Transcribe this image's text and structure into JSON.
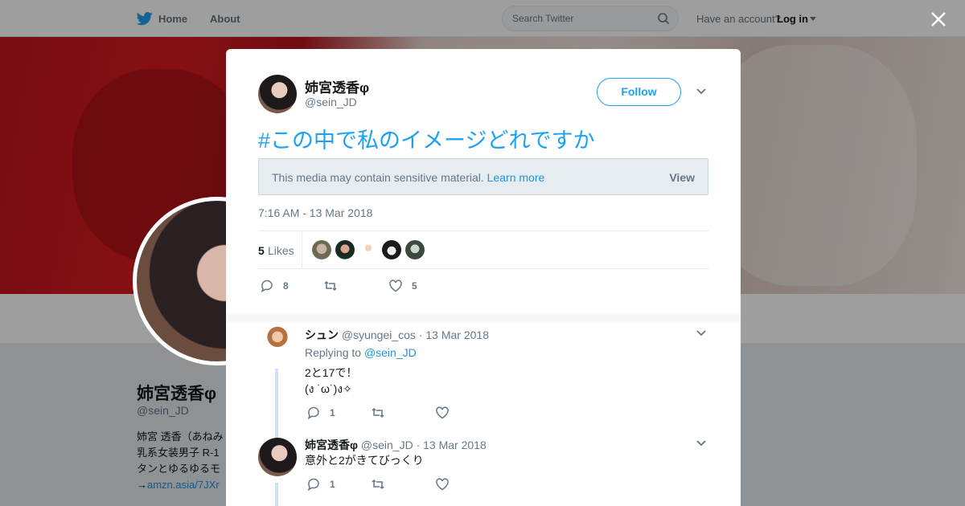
{
  "nav": {
    "home_label": "Home",
    "about_label": "About",
    "search_placeholder": "Search Twitter",
    "account_prompt": "Have an account?",
    "login_label": "Log in"
  },
  "background_profile": {
    "name": "姉宮透香φ",
    "handle": "@sein_JD",
    "bio_lines": [
      "姉宮 透香（あねみ",
      "乳系女装男子 R-1",
      "タンとゆるゆるモ"
    ],
    "bio_link_prefix": "→",
    "bio_link": "amzn.asia/7JXr"
  },
  "tweet": {
    "author_name": "姉宮透香φ",
    "author_handle": "@sein_JD",
    "follow_label": "Follow",
    "text": "#この中で私のイメージどれですか",
    "sensitive_text": "This media may contain sensitive material.",
    "sensitive_learn": "Learn more",
    "sensitive_view": "View",
    "timestamp": "7:16 AM - 13 Mar 2018",
    "likes_count": "5",
    "likes_label": "Likes",
    "reply_count": "8",
    "like_count_action": "5"
  },
  "replies": [
    {
      "name": "シュン",
      "handle": "@syungei_cos",
      "date": "· 13 Mar 2018",
      "replying_prefix": "Replying to",
      "replying_to": "@sein_JD",
      "body": "2と17で！\n(ง ˙ω˙)ง✧",
      "reply_count": "1"
    },
    {
      "name": "姉宮透香φ",
      "handle": "@sein_JD",
      "date": "· 13 Mar 2018",
      "body": "意外と2がきてびっくり",
      "reply_count": "1"
    }
  ],
  "colors": {
    "brand_blue": "#1da1f2",
    "link_blue": "#1b95e0",
    "muted": "#657786"
  }
}
